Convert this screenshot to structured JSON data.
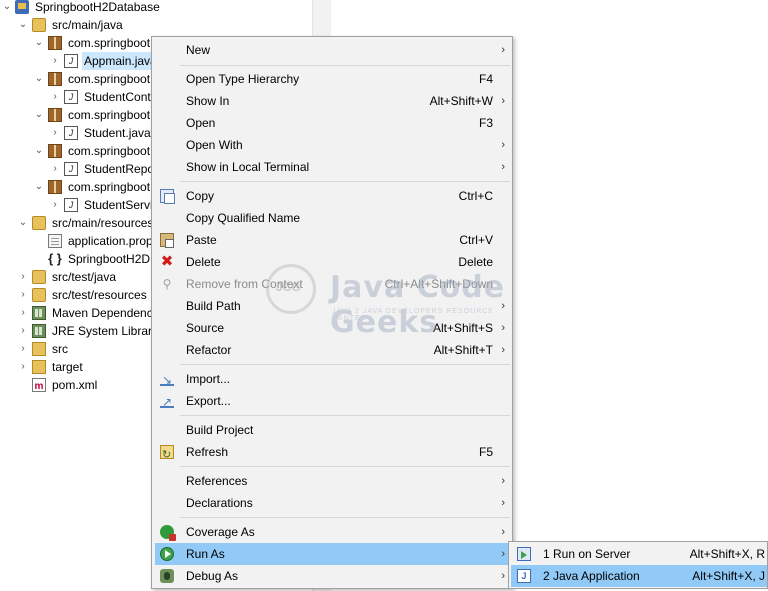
{
  "explorer": {
    "items": [
      {
        "label": "SpringbootH2Database",
        "chev": "⌄",
        "icon": "project-icon"
      },
      {
        "label": "src/main/java",
        "chev": "⌄",
        "icon": "source-folder-icon"
      },
      {
        "label": "com.springboot",
        "chev": "⌄",
        "icon": "package-icon"
      },
      {
        "label": "Appmain.java",
        "chev": "›",
        "icon": "java-file-icon"
      },
      {
        "label": "com.springboot",
        "chev": "⌄",
        "icon": "package-icon"
      },
      {
        "label": "StudentCont",
        "chev": "›",
        "icon": "java-file-icon"
      },
      {
        "label": "com.springboot",
        "chev": "⌄",
        "icon": "package-icon"
      },
      {
        "label": "Student.java",
        "chev": "›",
        "icon": "java-file-icon"
      },
      {
        "label": "com.springboot",
        "chev": "⌄",
        "icon": "package-icon"
      },
      {
        "label": "StudentRepo",
        "chev": "›",
        "icon": "java-file-icon"
      },
      {
        "label": "com.springboot",
        "chev": "⌄",
        "icon": "package-icon"
      },
      {
        "label": "StudentServi",
        "chev": "›",
        "icon": "java-file-icon"
      },
      {
        "label": "src/main/resources",
        "chev": "⌄",
        "icon": "source-folder-icon"
      },
      {
        "label": "application.prop",
        "chev": "",
        "icon": "properties-file-icon"
      },
      {
        "label": "SpringbootH2D",
        "chev": "",
        "icon": "json-braces-icon"
      },
      {
        "label": "src/test/java",
        "chev": "›",
        "icon": "source-folder-icon"
      },
      {
        "label": "src/test/resources",
        "chev": "›",
        "icon": "source-folder-icon"
      },
      {
        "label": "Maven Dependenc",
        "chev": "›",
        "icon": "library-icon"
      },
      {
        "label": "JRE System Library",
        "chev": "›",
        "icon": "library-icon"
      },
      {
        "label": "src",
        "chev": "›",
        "icon": "folder-icon"
      },
      {
        "label": "target",
        "chev": "›",
        "icon": "folder-icon"
      },
      {
        "label": "pom.xml",
        "chev": "",
        "icon": "xml-file-icon"
      }
    ]
  },
  "context_menu": {
    "items": [
      {
        "label": "New",
        "shortcut": "",
        "arrow": "›",
        "icon": ""
      },
      {
        "label": "Open Type Hierarchy",
        "shortcut": "F4",
        "arrow": "",
        "icon": ""
      },
      {
        "label": "Show In",
        "shortcut": "Alt+Shift+W",
        "arrow": "›",
        "icon": ""
      },
      {
        "label": "Open",
        "shortcut": "F3",
        "arrow": "",
        "icon": ""
      },
      {
        "label": "Open With",
        "shortcut": "",
        "arrow": "›",
        "icon": ""
      },
      {
        "label": "Show in Local Terminal",
        "shortcut": "",
        "arrow": "›",
        "icon": ""
      },
      {
        "label": "Copy",
        "shortcut": "Ctrl+C",
        "arrow": "",
        "icon": "copy-icon"
      },
      {
        "label": "Copy Qualified Name",
        "shortcut": "",
        "arrow": "",
        "icon": ""
      },
      {
        "label": "Paste",
        "shortcut": "Ctrl+V",
        "arrow": "",
        "icon": "paste-icon"
      },
      {
        "label": "Delete",
        "shortcut": "Delete",
        "arrow": "",
        "icon": "delete-icon"
      },
      {
        "label": "Remove from Context",
        "shortcut": "Ctrl+Alt+Shift+Down",
        "arrow": "",
        "icon": "remove-icon",
        "disabled": true
      },
      {
        "label": "Build Path",
        "shortcut": "",
        "arrow": "›",
        "icon": ""
      },
      {
        "label": "Source",
        "shortcut": "Alt+Shift+S",
        "arrow": "›",
        "icon": ""
      },
      {
        "label": "Refactor",
        "shortcut": "Alt+Shift+T",
        "arrow": "›",
        "icon": ""
      },
      {
        "label": "Import...",
        "shortcut": "",
        "arrow": "",
        "icon": "import-icon"
      },
      {
        "label": "Export...",
        "shortcut": "",
        "arrow": "",
        "icon": "export-icon"
      },
      {
        "label": "Build Project",
        "shortcut": "",
        "arrow": "",
        "icon": ""
      },
      {
        "label": "Refresh",
        "shortcut": "F5",
        "arrow": "",
        "icon": "refresh-icon"
      },
      {
        "label": "References",
        "shortcut": "",
        "arrow": "›",
        "icon": ""
      },
      {
        "label": "Declarations",
        "shortcut": "",
        "arrow": "›",
        "icon": ""
      },
      {
        "label": "Coverage As",
        "shortcut": "",
        "arrow": "›",
        "icon": "coverage-icon"
      },
      {
        "label": "Run As",
        "shortcut": "",
        "arrow": "›",
        "icon": "run-icon",
        "highlighted": true
      },
      {
        "label": "Debug As",
        "shortcut": "",
        "arrow": "›",
        "icon": "debug-icon"
      }
    ]
  },
  "submenu": {
    "items": [
      {
        "label": "1 Run on Server",
        "shortcut": "Alt+Shift+X, R",
        "icon": "run-on-server-icon"
      },
      {
        "label": "2 Java Application",
        "shortcut": "Alt+Shift+X, J",
        "icon": "java-application-icon",
        "highlighted": true
      }
    ]
  },
  "watermark": {
    "initials": "JCG",
    "title": "Java Code Geeks",
    "subtitle": "JAVA 2 JAVA DEVELOPERS RESOURCE CENTER"
  },
  "colors": {
    "highlight": "#91c9f7",
    "menu_bg": "#f2f2f2",
    "selection": "#cce8ff"
  }
}
